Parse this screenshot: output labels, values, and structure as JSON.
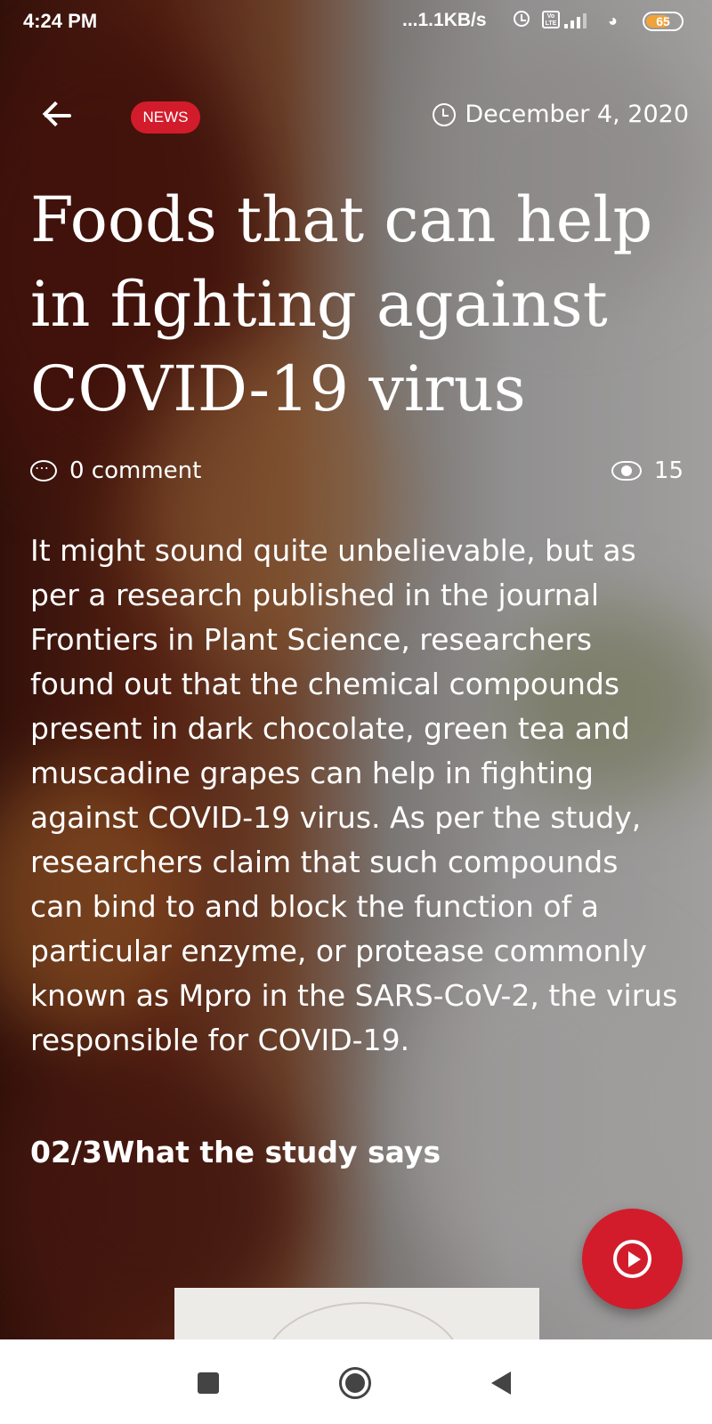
{
  "status_bar": {
    "time": "4:24 PM",
    "network_speed": "...1.1KB/s",
    "volte": "Vo LTE",
    "battery": "65"
  },
  "header": {
    "category_badge": "NEWS",
    "date": "December 4, 2020"
  },
  "article": {
    "title": "Foods that can help in fighting against COVID-19 virus",
    "comments": "0 comment",
    "views": "15",
    "body": "It might sound quite unbelievable, but as per a research published in the journal Frontiers in Plant Science, researchers found out that the chemical compounds present in dark chocolate, green tea and muscadine grapes can help in fighting against COVID-19 virus. As per the study, researchers claim that such compounds can bind to and block the function of a particular enzyme, or protease commonly known as Mpro in the SARS-CoV-2, the virus responsible for COVID-19.",
    "subheading": "02/3What the study says"
  },
  "colors": {
    "accent": "#d21c2b",
    "navbar_bg": "#ffffff",
    "navbar_icon": "#444444"
  },
  "icons": [
    "back-arrow-icon",
    "clock-icon",
    "comment-icon",
    "eye-icon",
    "play-icon",
    "recent-apps-icon",
    "home-icon",
    "nav-back-icon"
  ]
}
